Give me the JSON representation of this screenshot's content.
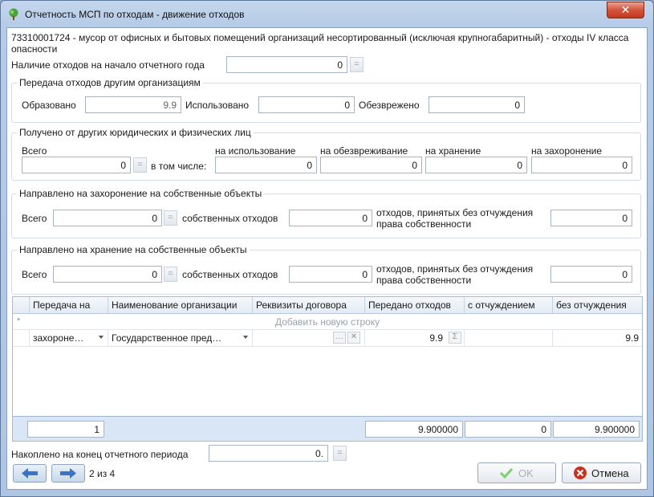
{
  "window": {
    "title": "Отчетность МСП по отходам - движение отходов",
    "close_glyph": "✕"
  },
  "waste_description": "73310001724 - мусор от офисных и бытовых помещений организаций несортированный (исключая крупногабаритный) - отходы IV класса опасности",
  "start_balance": {
    "label": "Наличие отходов на начало отчетного года",
    "value": "0"
  },
  "eq_glyph": "=",
  "transfer_group": {
    "title": "Передача отходов другим организациям",
    "formed_label": "Образовано",
    "formed_value": "9.9",
    "used_label": "Использовано",
    "used_value": "0",
    "neutralized_label": "Обезврежено",
    "neutralized_value": "0"
  },
  "received_group": {
    "title": "Получено от других юридических и физических лиц",
    "total_label": "Всего",
    "total_value": "0",
    "incl_label": "в том числе:",
    "use_label": "на использование",
    "use_value": "0",
    "neutral_label": "на обезвреживание",
    "neutral_value": "0",
    "storage_label": "на хранение",
    "storage_value": "0",
    "burial_label": "на захоронение",
    "burial_value": "0"
  },
  "burial_group": {
    "title": "Направлено на захоронение на собственные объекты",
    "total_label": "Всего",
    "total_value": "0",
    "own_label": "собственных отходов",
    "own_value": "0",
    "accepted_label_1": "отходов, принятых без отчуждения",
    "accepted_label_2": "права собственности",
    "accepted_value": "0"
  },
  "storage_group": {
    "title": "Направлено на хранение на собственные объекты",
    "total_label": "Всего",
    "total_value": "0",
    "own_label": "собственных отходов",
    "own_value": "0",
    "accepted_label_1": "отходов, принятых без отчуждения",
    "accepted_label_2": "права собственности",
    "accepted_value": "0"
  },
  "grid": {
    "columns": [
      "Передача на",
      "Наименование организации",
      "Реквизиты договора",
      "Передано отходов",
      "с отчуждением",
      "без отчуждения"
    ],
    "add_row_text": "Добавить новую строку",
    "new_row_marker": "*",
    "rows": [
      {
        "transfer_to": "захороне…",
        "organization": "Государственное пред…",
        "contract": "",
        "transferred": "9.9",
        "with_alienation": "",
        "without_alienation": "9.9"
      }
    ],
    "ellipsis_glyph": "…",
    "clear_glyph": "✕",
    "sum_glyph": "Σ",
    "footer": {
      "count": "1",
      "transferred_total": "9.900000",
      "with_alienation_total": "0",
      "without_alienation_total": "9.900000"
    }
  },
  "end_balance": {
    "label": "Накоплено на конец отчетного периода",
    "value": "0."
  },
  "navigation": {
    "position": "2 из 4"
  },
  "buttons": {
    "ok": "OK",
    "cancel": "Отмена"
  },
  "colors": {
    "accent": "#3a75c4",
    "ok_check": "#7fcf6a",
    "cancel_icon": "#c9311d"
  }
}
